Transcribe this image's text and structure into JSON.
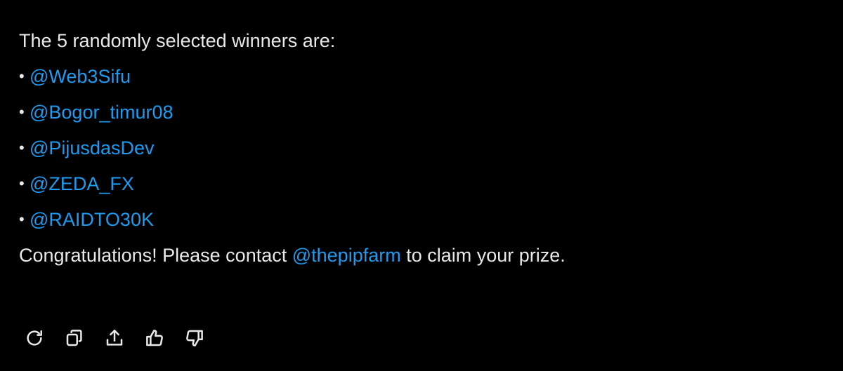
{
  "message": {
    "intro": "The 5 randomly selected winners are:",
    "bullet": "•",
    "winners": [
      "@Web3Sifu",
      "@Bogor_timur08",
      "@PijusdasDev",
      "@ZEDA_FX",
      "@RAIDTO30K"
    ],
    "closing_before": "Congratulations! Please contact ",
    "closing_mention": "@thepipfarm",
    "closing_after": " to claim your prize."
  },
  "actions": [
    {
      "name": "regenerate",
      "icon": "refresh-icon"
    },
    {
      "name": "copy",
      "icon": "copy-icon"
    },
    {
      "name": "share",
      "icon": "share-icon"
    },
    {
      "name": "thumbs-up",
      "icon": "thumbs-up-icon"
    },
    {
      "name": "thumbs-down",
      "icon": "thumbs-down-icon"
    }
  ],
  "colors": {
    "background": "#000000",
    "text": "#e7e9ea",
    "mention": "#1d9bf0"
  }
}
